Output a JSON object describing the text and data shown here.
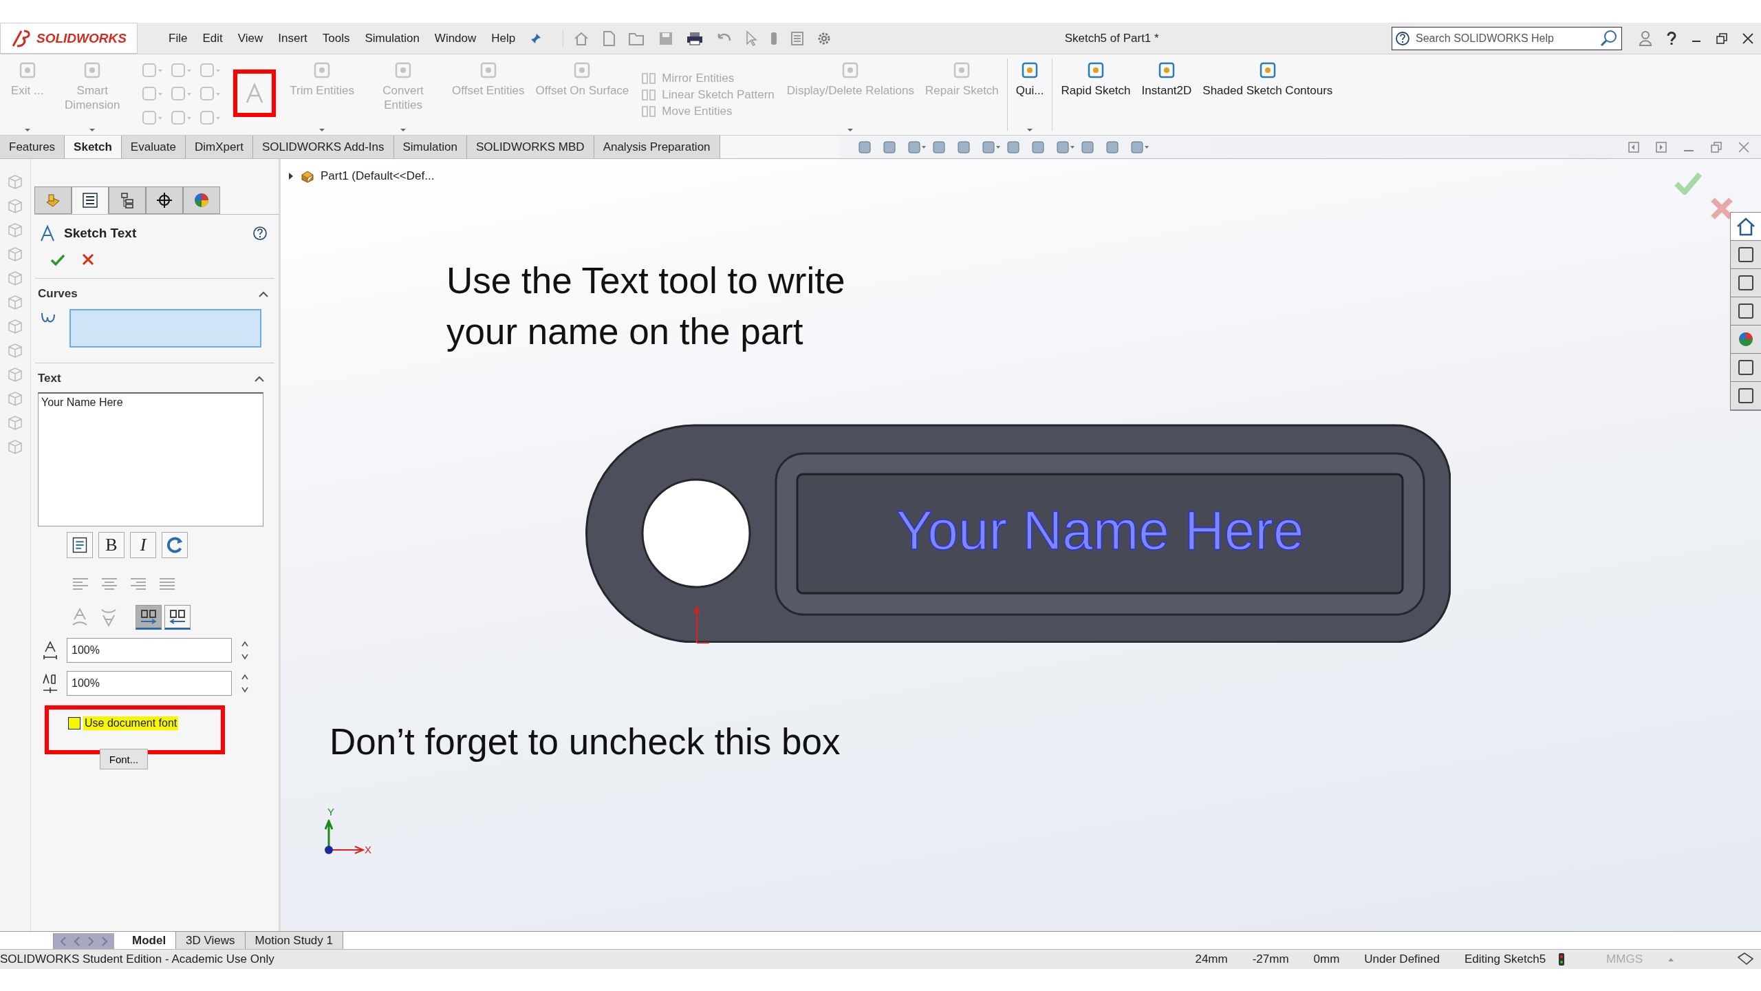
{
  "title_bar": {
    "logo": "SOLIDWORKS",
    "menu": [
      "File",
      "Edit",
      "View",
      "Insert",
      "Tools",
      "Simulation",
      "Window",
      "Help"
    ],
    "document_title": "Sketch5 of Part1 *",
    "search": {
      "placeholder": "Search SOLIDWORKS Help"
    }
  },
  "ribbon": [
    {
      "kind": "large",
      "label": "Exit ...",
      "disabled": true,
      "dropdown": true
    },
    {
      "kind": "large",
      "label": "Smart Dimension",
      "disabled": true,
      "dropdown": true
    },
    {
      "kind": "sketch_entities",
      "disabled": true
    },
    {
      "kind": "text_tool",
      "disabled": true
    },
    {
      "kind": "large",
      "label": "Trim Entities",
      "disabled": true,
      "dropdown": true
    },
    {
      "kind": "large",
      "label": "Convert Entities",
      "disabled": true,
      "dropdown": true
    },
    {
      "kind": "large",
      "label": "Offset Entities",
      "disabled": true,
      "dropdown": false
    },
    {
      "kind": "large",
      "label": "Offset On Surface",
      "disabled": true,
      "dropdown": false
    },
    {
      "kind": "stack",
      "items": [
        {
          "label": "Mirror Entities",
          "disabled": true
        },
        {
          "label": "Linear Sketch Pattern",
          "disabled": true
        },
        {
          "label": "Move Entities",
          "disabled": true
        }
      ]
    },
    {
      "kind": "large",
      "label": "Display/Delete Relations",
      "disabled": true,
      "dropdown": true
    },
    {
      "kind": "large",
      "label": "Repair Sketch",
      "disabled": true,
      "dropdown": false
    },
    {
      "kind": "large",
      "label": "Qui...",
      "disabled": false,
      "dropdown": true
    },
    {
      "kind": "large",
      "label": "Rapid Sketch",
      "disabled": false,
      "dropdown": false
    },
    {
      "kind": "large",
      "label": "Instant2D",
      "disabled": false,
      "dropdown": false
    },
    {
      "kind": "large",
      "label": "Shaded Sketch Contours",
      "disabled": false,
      "dropdown": false
    }
  ],
  "command_tabs": [
    {
      "label": "Features",
      "selected": false
    },
    {
      "label": "Sketch",
      "selected": true
    },
    {
      "label": "Evaluate",
      "selected": false
    },
    {
      "label": "DimXpert",
      "selected": false
    },
    {
      "label": "SOLIDWORKS Add-Ins",
      "selected": false
    },
    {
      "label": "Simulation",
      "selected": false
    },
    {
      "label": "SOLIDWORKS MBD",
      "selected": false
    },
    {
      "label": "Analysis Preparation",
      "selected": false
    }
  ],
  "property_manager": {
    "tabs": [
      {
        "selected": false
      },
      {
        "selected": true
      },
      {
        "selected": false
      },
      {
        "selected": false
      },
      {
        "selected": false
      }
    ],
    "title": "Sketch Text",
    "curves": {
      "title": "Curves",
      "expanded": true
    },
    "text": {
      "title": "Text",
      "expanded": true,
      "value": "Your Name Here",
      "style_buttons": [
        {
          "label": "B",
          "selected": false
        },
        {
          "label": "I",
          "selected": false
        }
      ],
      "direction_buttons": [
        {
          "selected": true
        },
        {
          "selected": false
        }
      ],
      "scales": [
        "100%",
        "100%"
      ],
      "use_document_font": {
        "label": "Use document font",
        "checked": false
      },
      "font_button": "Font..."
    }
  },
  "viewport": {
    "feature_tree": {
      "part": "Part1",
      "configuration": "(Default<<Def..."
    },
    "instructions": [
      "Use the Text tool to write\nyour name on the part",
      "Don’t forget to uncheck this box"
    ],
    "part_text": "Your Name Here",
    "axes": {
      "x": "X",
      "y": "Y"
    }
  },
  "bottom_tabs": [
    {
      "label": "Model",
      "selected": true
    },
    {
      "label": "3D Views",
      "selected": false
    },
    {
      "label": "Motion Study 1",
      "selected": false
    }
  ],
  "status_bar": {
    "edition": "SOLIDWORKS Student Edition - Academic Use Only",
    "fields": [
      "24mm",
      "-27mm",
      "0mm",
      "Under Defined",
      "Editing Sketch5"
    ],
    "units": "MMGS"
  }
}
